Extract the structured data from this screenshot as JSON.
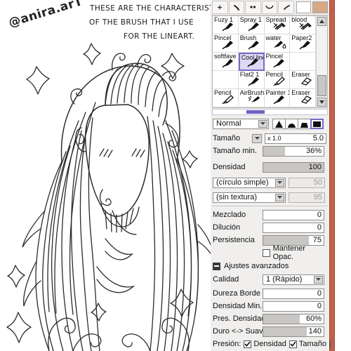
{
  "artwork": {
    "signature": "@anira.arT",
    "note_line1": "THESE ARE THE CHARACTERISTICS",
    "note_line2": "OF THE BRUSH THAT I USE",
    "note_line3": "FOR THE LINEART.",
    "subject": "lineart drawing of a girl with long wavy hair, blank face with blush marks, sparkles",
    "ink_color": "#2b2b2b"
  },
  "panel": {
    "accent_bar_color": "#c4604a",
    "selection_color": "#7b68c9",
    "toolbar": {
      "buttons": [
        {
          "name": "brush-dot-icon",
          "glyph": "+"
        },
        {
          "name": "brush-stroke-icon",
          "glyph": "\\"
        },
        {
          "name": "brush-dots-icon",
          "glyph": ".."
        },
        {
          "name": "brush-curve-icon",
          "glyph": "∪"
        },
        {
          "name": "brush-flick-icon",
          "glyph": "/"
        }
      ],
      "swatch_white": "#ffffff",
      "swatch_tan": "#d6a884"
    },
    "brush_grid": {
      "selected": "Cool line",
      "cells": [
        {
          "label": "Fuzy 1",
          "icon": "brush-icon"
        },
        {
          "label": "Spray 1",
          "icon": "brush-icon"
        },
        {
          "label": "Spread",
          "icon": "spread-icon"
        },
        {
          "label": "blood",
          "icon": "spread-icon"
        },
        {
          "label": "Pincel",
          "icon": "brush-icon"
        },
        {
          "label": "Brush",
          "icon": "brush-icon"
        },
        {
          "label": "water",
          "icon": "waterbrush-icon"
        },
        {
          "label": "Paper2",
          "icon": "brush-icon"
        },
        {
          "label": "softfave",
          "icon": "brush-icon"
        },
        {
          "label": "Cool line",
          "icon": "brush-icon"
        },
        {
          "label": "Pincel",
          "icon": "brush-icon"
        },
        {
          "label": "",
          "icon": ""
        },
        {
          "label": "",
          "icon": ""
        },
        {
          "label": "Flat2 1",
          "icon": "brush-icon"
        },
        {
          "label": "Pencil",
          "icon": "pencil-icon"
        },
        {
          "label": "Eraser",
          "icon": "eraser-icon"
        },
        {
          "label": "Pencil",
          "icon": "pencil-icon"
        },
        {
          "label": "AirBrush",
          "icon": "airbrush-icon"
        },
        {
          "label": "Painter 1",
          "icon": "brush-icon"
        },
        {
          "label": "Eraser",
          "icon": "eraser-icon"
        }
      ]
    },
    "blend_mode": "Normal",
    "shape_buttons": [
      {
        "name": "shape-sharp",
        "selected": false
      },
      {
        "name": "shape-round",
        "selected": false
      },
      {
        "name": "shape-flat",
        "selected": false
      },
      {
        "name": "shape-square",
        "selected": true
      }
    ],
    "params": {
      "size_label": "Tamaño",
      "size_mult": "x 1.0",
      "size_value": "5.0",
      "size_min_label": "Tamaño min.",
      "size_min_value": "36%",
      "size_min_fill": 36,
      "density_label": "Densidad",
      "density_value": "100",
      "density_fill": 100,
      "shape_select": "(círculo simple)",
      "shape_amount": "50",
      "texture_select": "(sin textura)",
      "texture_amount": "95",
      "blending_label": "Mezclado",
      "blending_value": "0",
      "blending_fill": 0,
      "dilution_label": "Dilución",
      "dilution_value": "0",
      "dilution_fill": 0,
      "persistence_label": "Persistencia",
      "persistence_value": "75",
      "persistence_fill": 75,
      "keep_opacity_label": "Mantener Opac.",
      "keep_opacity_checked": false,
      "advanced_label": "Ajustes avanzados",
      "quality_label": "Calidad",
      "quality_value": "1 (Rápido)",
      "edge_hardness_label": "Dureza Borde",
      "edge_hardness_value": "0",
      "edge_hardness_fill": 0,
      "min_density_label": "Densidad Min.",
      "min_density_value": "0",
      "min_density_fill": 0,
      "pres_density_label": "Pres. Densidad I",
      "pres_density_value": "60%",
      "pres_density_fill": 60,
      "hard_soft_label": "Duro <-> Suave",
      "hard_soft_value": "140",
      "hard_soft_fill": 72,
      "pressure_label": "Presión:",
      "pressure_density_label": "Densidad",
      "pressure_density_checked": true,
      "pressure_size_label": "Tamaño",
      "pressure_size_checked": true,
      "pressure_third_checked": false
    }
  }
}
